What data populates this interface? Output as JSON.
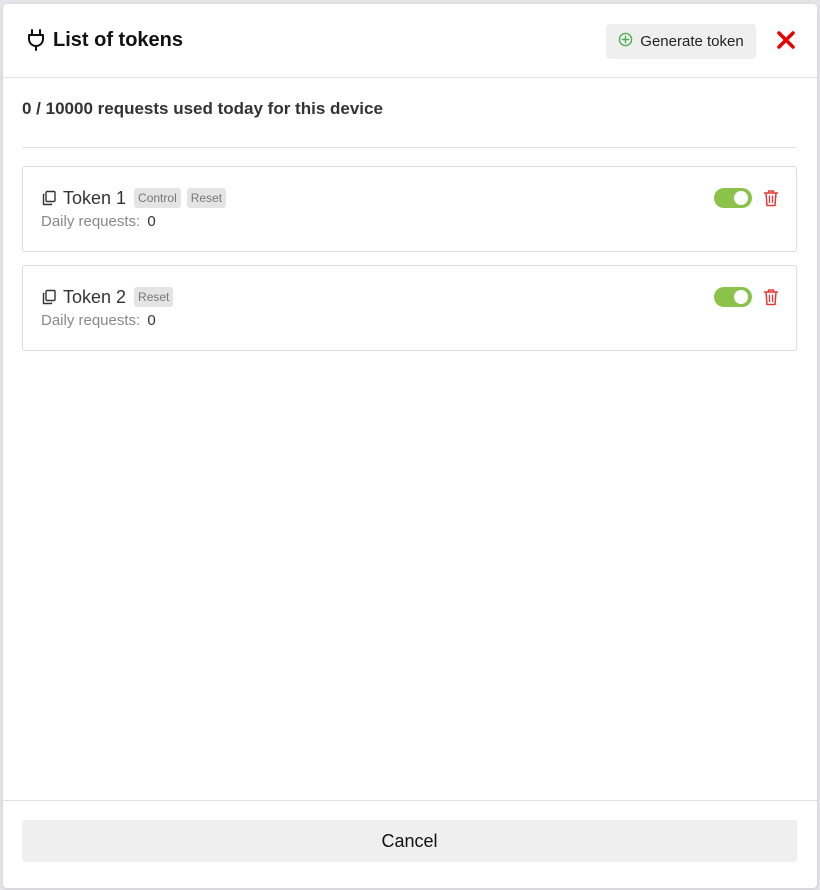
{
  "modal": {
    "title": "List of tokens",
    "generate_label": "Generate token",
    "close_icon": "close-icon",
    "plug_icon": "plug-icon"
  },
  "usage_text": "0 / 10000 requests used today for this device",
  "tokens": [
    {
      "name": "Token 1",
      "tags": [
        "Control",
        "Reset"
      ],
      "daily_label": "Daily requests:",
      "daily_value": "0",
      "enabled": true
    },
    {
      "name": "Token 2",
      "tags": [
        "Reset"
      ],
      "daily_label": "Daily requests:",
      "daily_value": "0",
      "enabled": true
    }
  ],
  "footer": {
    "cancel_label": "Cancel"
  },
  "colors": {
    "toggle_on": "#8bc34a",
    "delete": "#e53935",
    "close": "#e60000",
    "add": "#4caf50"
  }
}
